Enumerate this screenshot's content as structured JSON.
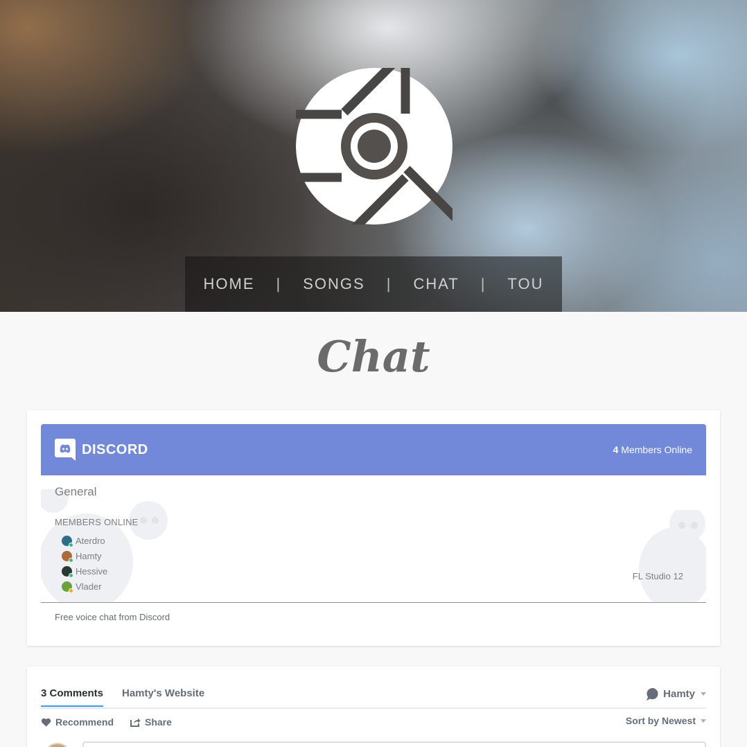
{
  "nav": {
    "items": [
      "HOME",
      "SONGS",
      "CHAT",
      "TOU"
    ],
    "separator": "|"
  },
  "page": {
    "title": "Chat"
  },
  "discord": {
    "wordmark": "DISCORD",
    "online_count": "4",
    "online_label": "Members Online",
    "channel": "General",
    "members_label": "MEMBERS ONLINE",
    "members": [
      {
        "name": "Aterdro",
        "avatar_color": "#2c6e8a",
        "status_color": "#43b581"
      },
      {
        "name": "Hamty",
        "avatar_color": "#b06a3a",
        "status_color": "#43b581"
      },
      {
        "name": "Hessive",
        "avatar_color": "#2b3a2e",
        "status_color": "#43b581"
      },
      {
        "name": "Vlader",
        "avatar_color": "#6aa33a",
        "status_color": "#faa61a"
      }
    ],
    "game": "FL Studio 12",
    "footer": "Free voice chat from Discord",
    "brand_color": "#7289da"
  },
  "comments": {
    "count_label": "3 Comments",
    "site_label": "Hamty's Website",
    "user": "Hamty",
    "recommend_label": "Recommend",
    "share_label": "Share",
    "sort_label": "Sort by Newest",
    "accent_color": "#2e9fff"
  }
}
